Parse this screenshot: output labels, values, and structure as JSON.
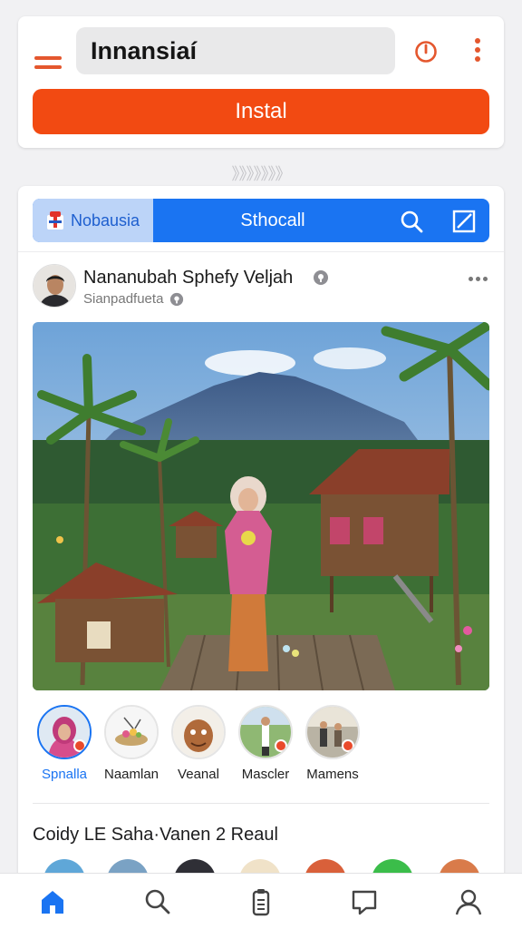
{
  "header": {
    "app_title": "Innansiaí",
    "install_label": "Instal",
    "menu_icon": "hamburger-icon",
    "power_icon": "power-icon",
    "more_icon": "vertical-dots-icon"
  },
  "pager": {
    "text": "》》》》》》》"
  },
  "tabs": {
    "left_label": "Nobausia",
    "right_label": "Sthocall",
    "left_icon": "flag-icon",
    "search_icon": "search-icon",
    "edit_icon": "edit-icon"
  },
  "post": {
    "author_name": "Nananubah Sphefy Veljah",
    "author_subtitle": "Sianpadfueta",
    "verified_icon": "location-pin-icon",
    "more_icon": "horizontal-dots-icon",
    "photo_description_icon": "landscape-photo"
  },
  "stories": [
    {
      "label": "Spnalla",
      "active": true
    },
    {
      "label": "Naamlan",
      "active": false
    },
    {
      "label": "Veanal",
      "active": false
    },
    {
      "label": "Mascler",
      "active": false
    },
    {
      "label": "Mamens",
      "active": false
    }
  ],
  "section": {
    "title": "Coidy LE Saha·Vanen 2 Reaul"
  },
  "bottom_nav": [
    {
      "name": "home",
      "icon": "home-icon"
    },
    {
      "name": "search",
      "icon": "search-icon"
    },
    {
      "name": "clipboard",
      "icon": "clipboard-icon"
    },
    {
      "name": "messages",
      "icon": "chat-icon"
    },
    {
      "name": "profile",
      "icon": "user-icon"
    }
  ],
  "colors": {
    "accent_orange": "#f24a12",
    "accent_blue": "#1a74f2",
    "icon_orange": "#e4572e"
  }
}
